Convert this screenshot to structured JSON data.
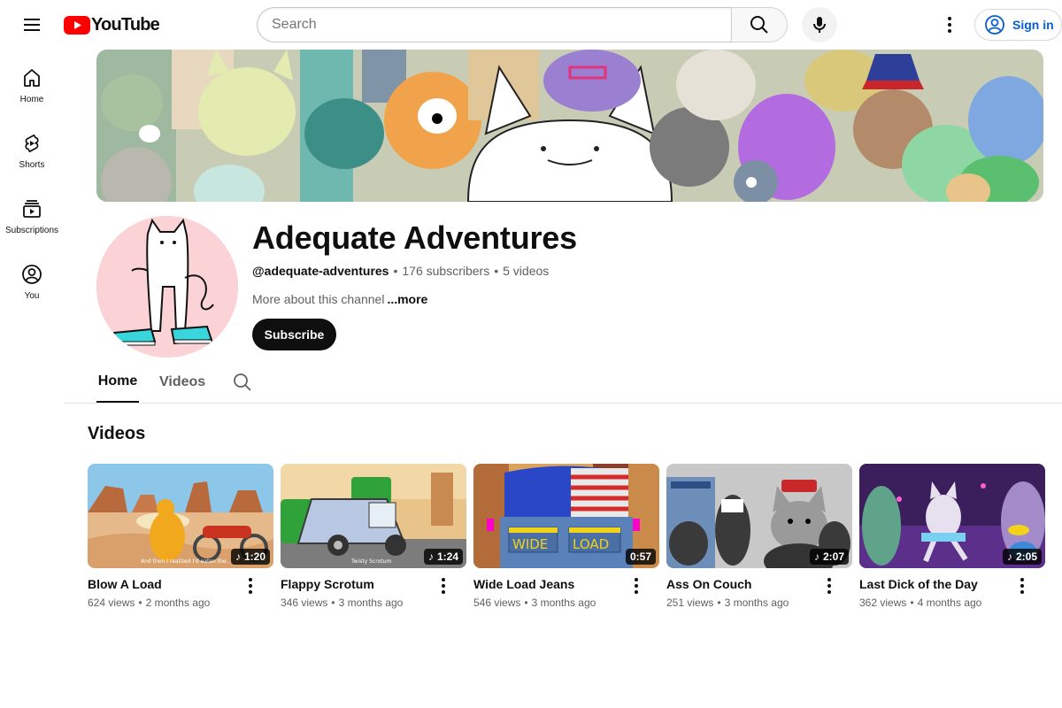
{
  "header": {
    "logo_text": "YouTube",
    "search_placeholder": "Search",
    "sign_in_label": "Sign in"
  },
  "sidebar": {
    "items": [
      {
        "label": "Home",
        "icon": "home-icon"
      },
      {
        "label": "Shorts",
        "icon": "shorts-icon"
      },
      {
        "label": "Subscriptions",
        "icon": "subscriptions-icon"
      },
      {
        "label": "You",
        "icon": "you-icon"
      }
    ]
  },
  "channel": {
    "name": "Adequate Adventures",
    "handle": "@adequate-adventures",
    "subscribers": "176 subscribers",
    "videos_count": "5 videos",
    "description": "More about this channel",
    "more_label": "...more",
    "subscribe_label": "Subscribe"
  },
  "tabs": [
    {
      "label": "Home",
      "selected": true
    },
    {
      "label": "Videos",
      "selected": false
    }
  ],
  "section": {
    "title": "Videos"
  },
  "videos": [
    {
      "title": "Blow A Load",
      "views": "624 views",
      "age": "2 months ago",
      "duration": "1:20",
      "music": true
    },
    {
      "title": "Flappy Scrotum",
      "views": "346 views",
      "age": "3 months ago",
      "duration": "1:24",
      "music": true
    },
    {
      "title": "Wide Load Jeans",
      "views": "546 views",
      "age": "3 months ago",
      "duration": "0:57",
      "music": false
    },
    {
      "title": "Ass On Couch",
      "views": "251 views",
      "age": "3 months ago",
      "duration": "2:07",
      "music": true
    },
    {
      "title": "Last Dick of the Day",
      "views": "362 views",
      "age": "4 months ago",
      "duration": "2:05",
      "music": true
    }
  ],
  "thumbnail_text": {
    "v1_caption": "And then I realized I'd eaten the...",
    "v2_caption": "Twisty Scrotum",
    "v3_left": "WIDE",
    "v3_right": "LOAD"
  },
  "colors": {
    "brand_red": "#ff0000",
    "link_blue": "#065fd4",
    "avatar_bg": "#fbd2d6"
  }
}
